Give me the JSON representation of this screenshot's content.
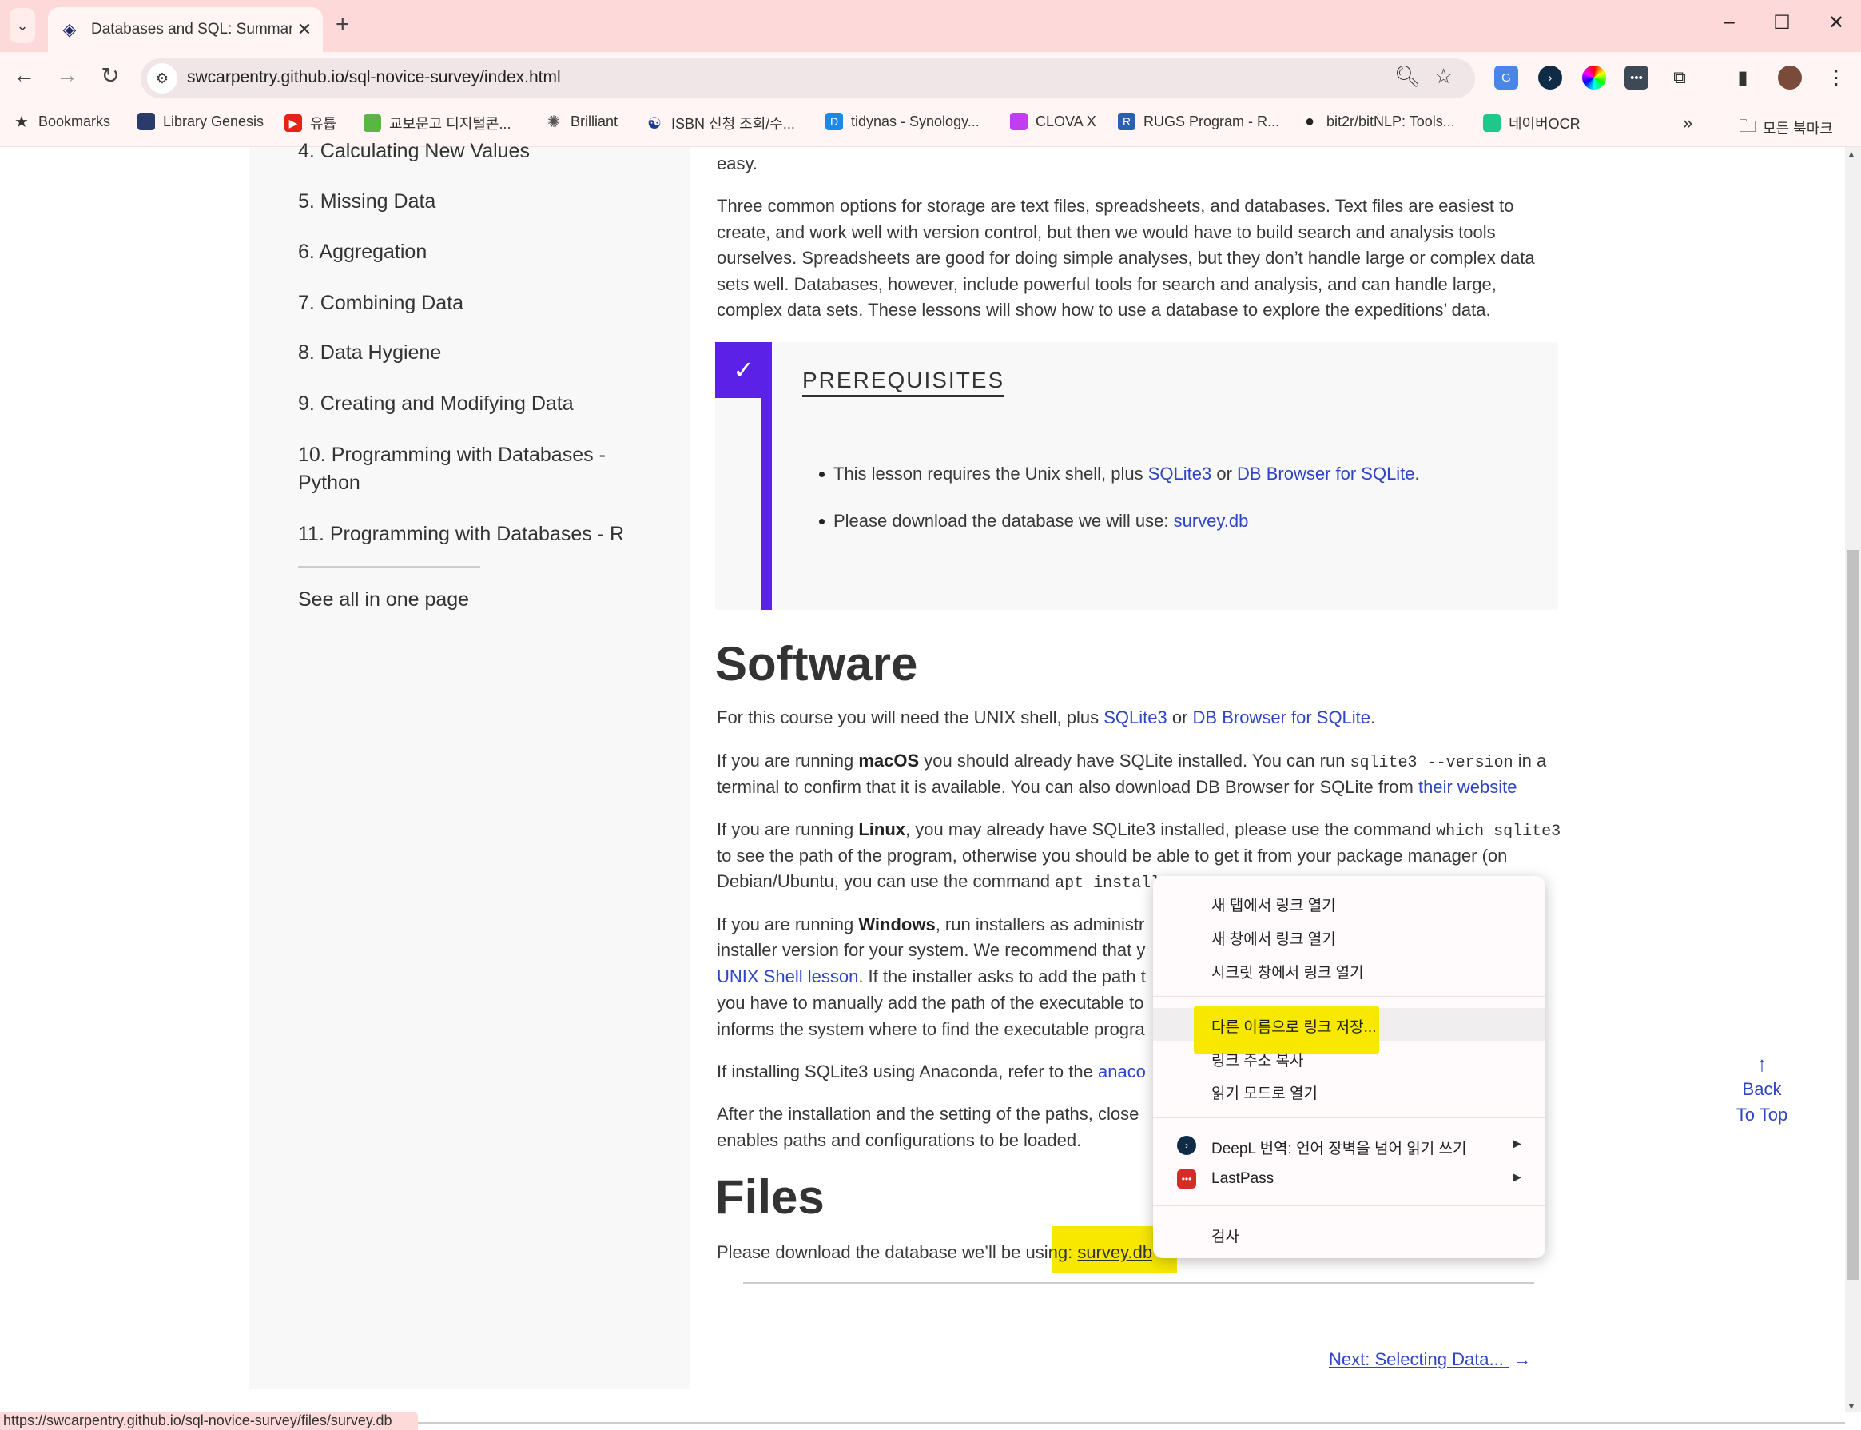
{
  "browser": {
    "tab_title": "Databases and SQL: Summary",
    "url": "swcarpentry.github.io/sql-novice-survey/index.html",
    "status_url": "https://swcarpentry.github.io/sql-novice-survey/files/survey.db",
    "bookmarks": [
      {
        "label": "Bookmarks",
        "icon": "star-icon",
        "color": "#333333"
      },
      {
        "label": "Library Genesis",
        "icon": "libgen-icon",
        "color": "#2a3a6a"
      },
      {
        "label": "유튭",
        "icon": "youtube-icon",
        "color": "#e62117"
      },
      {
        "label": "교보문고 디지털콘...",
        "icon": "kyobo-icon",
        "color": "#5bb543"
      },
      {
        "label": "Brilliant",
        "icon": "brilliant-icon",
        "color": "#555555"
      },
      {
        "label": "ISBN 신청 조회/수...",
        "icon": "korea-flag-icon",
        "color": "#1d3c8f"
      },
      {
        "label": "tidynas - Synology...",
        "icon": "dsm-icon",
        "color": "#1e88e5"
      },
      {
        "label": "CLOVA X",
        "icon": "clova-icon",
        "color": "#c23cf0"
      },
      {
        "label": "RUGS Program - R...",
        "icon": "r-icon",
        "color": "#2b5fb3"
      },
      {
        "label": "bit2r/bitNLP: Tools...",
        "icon": "github-icon",
        "color": "#222222"
      },
      {
        "label": "네이버OCR",
        "icon": "naver-clova-icon",
        "color": "#1fc88a"
      }
    ],
    "all_bookmarks": "모든 북마크"
  },
  "sidebar": {
    "items": [
      "4. Calculating New Values",
      "5. Missing Data",
      "6. Aggregation",
      "7. Combining Data",
      "8. Data Hygiene",
      "9. Creating and Modifying Data",
      "10. Programming with Databases -",
      "Python",
      "11. Programming with Databases - R"
    ],
    "see_all": "See all in one page"
  },
  "content": {
    "intro_lines": [
      [
        {
          "t": "easy."
        }
      ],
      [
        {
          "t": "Three common options for storage are text files, spreadsheets, and databases. Text files are easiest to"
        }
      ],
      [
        {
          "t": "create, and work well with version control, but then we would have to build search and analysis tools"
        }
      ],
      [
        {
          "t": "ourselves. Spreadsheets are good for doing simple analyses, but they don’t handle large or complex data"
        }
      ],
      [
        {
          "t": "sets well. Databases, however, include powerful tools for search and analysis, and can handle large,"
        }
      ],
      [
        {
          "t": "complex data sets. These lessons will show how to use a database to explore the expeditions’ data."
        }
      ]
    ],
    "prereq_title": "PREREQUISITES",
    "prereq_items": [
      [
        {
          "t": "This lesson requires the Unix shell, plus "
        },
        {
          "t": "SQLite3",
          "k": "a"
        },
        {
          "t": " or "
        },
        {
          "t": "DB Browser for SQLite",
          "k": "a"
        },
        {
          "t": "."
        }
      ],
      [
        {
          "t": "Please download the database we will use: "
        },
        {
          "t": "survey.db",
          "k": "a"
        }
      ]
    ],
    "software_heading": "Software",
    "software_lines": [
      [
        {
          "t": "For this course you will need the UNIX shell, plus "
        },
        {
          "t": "SQLite3",
          "k": "a"
        },
        {
          "t": " or "
        },
        {
          "t": "DB Browser for SQLite",
          "k": "a"
        },
        {
          "t": "."
        }
      ],
      [
        {
          "t": "If you are running "
        },
        {
          "t": "macOS",
          "k": "b"
        },
        {
          "t": " you should already have SQLite installed. You can run "
        },
        {
          "t": "sqlite3 --version",
          "k": "c"
        },
        {
          "t": " in a"
        }
      ],
      [
        {
          "t": "terminal to confirm that it is available. You can also download DB Browser for SQLite from "
        },
        {
          "t": "their website",
          "k": "a"
        }
      ],
      [
        {
          "t": "If you are running "
        },
        {
          "t": "Linux",
          "k": "b"
        },
        {
          "t": ", you may already have SQLite3 installed, please use the command "
        },
        {
          "t": "which sqlite3",
          "k": "c"
        }
      ],
      [
        {
          "t": "to see the path of the program, otherwise you should be able to get it from your package manager (on"
        }
      ],
      [
        {
          "t": "Debian/Ubuntu, you can use the command "
        },
        {
          "t": "apt install",
          "k": "c"
        }
      ],
      [
        {
          "t": "If you are running "
        },
        {
          "t": "Windows",
          "k": "b"
        },
        {
          "t": ", run installers as administr"
        }
      ],
      [
        {
          "t": "installer version for your system. We recommend that y"
        }
      ],
      [
        {
          "t": "UNIX Shell lesson",
          "k": "a"
        },
        {
          "t": ". If the installer asks to add the path t"
        }
      ],
      [
        {
          "t": "you have to manually add the path of the executable to"
        }
      ],
      [
        {
          "t": "informs the system where to find the executable progra"
        }
      ],
      [
        {
          "t": "If installing SQLite3 using Anaconda, refer to the "
        },
        {
          "t": "anaco",
          "k": "a"
        }
      ],
      [
        {
          "t": "After the installation and the setting of the paths, close"
        }
      ],
      [
        {
          "t": "enables paths and configurations to be loaded."
        }
      ]
    ],
    "files_heading": "Files",
    "files_lines": [
      [
        {
          "t": "Please download the database we’ll be using: "
        },
        {
          "t": "survey.db",
          "k": "a"
        }
      ]
    ],
    "next_link": "Next: Selecting Data...",
    "back_to_top": [
      "Back",
      "To Top"
    ]
  },
  "context_menu": {
    "items": [
      {
        "label": "새 탭에서 링크 열기"
      },
      {
        "label": "새 창에서 링크 열기"
      },
      {
        "label": "시크릿 창에서 링크 열기"
      },
      {
        "label": "다른 이름으로 링크 저장...",
        "hovered": true
      },
      {
        "label": "링크 주소 복사"
      },
      {
        "label": "읽기 모드로 열기"
      },
      {
        "label": "DeepL 번역: 언어 장벽을 넘어 읽기  쓰기",
        "icon": "deepl-icon",
        "submenu": true
      },
      {
        "label": "LastPass",
        "icon": "lastpass-icon",
        "submenu": true
      },
      {
        "label": "검사"
      }
    ]
  },
  "colors": {
    "accent": "#5b21e6",
    "link": "#2f45c4",
    "highlight": "#f8e800",
    "tabbar": "#fddad9"
  }
}
